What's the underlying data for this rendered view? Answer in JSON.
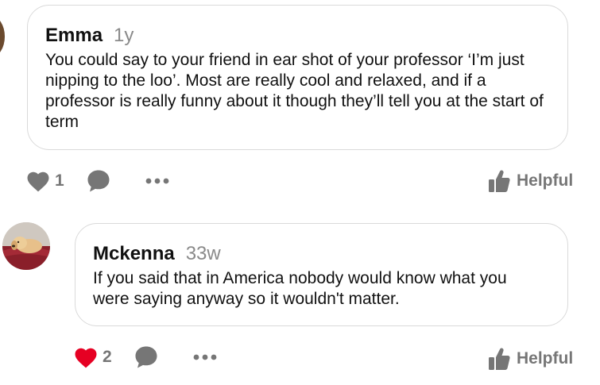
{
  "comments": [
    {
      "author": "Emma",
      "age": "1y",
      "text": "You could say to your friend in ear shot of your professor ‘I’m just nipping to the loo’. Most are really cool and relaxed, and if a professor is really funny about it though they’ll tell you at the start of term",
      "likes": "1",
      "liked": false,
      "helpful_label": "Helpful"
    },
    {
      "author": "Mckenna",
      "age": "33w",
      "text": "If you said that in America nobody would know what you were saying anyway so it wouldn't matter.",
      "likes": "2",
      "liked": true,
      "helpful_label": "Helpful"
    }
  ],
  "colors": {
    "icon_gray": "#767676",
    "liked_red": "#e60023",
    "bubble_border": "#dadada",
    "muted_text": "#8a8a8a"
  },
  "icons": {
    "like": "heart-icon",
    "comment": "speech-bubble-icon",
    "more": "ellipsis-icon",
    "helpful": "thumbs-up-icon"
  }
}
